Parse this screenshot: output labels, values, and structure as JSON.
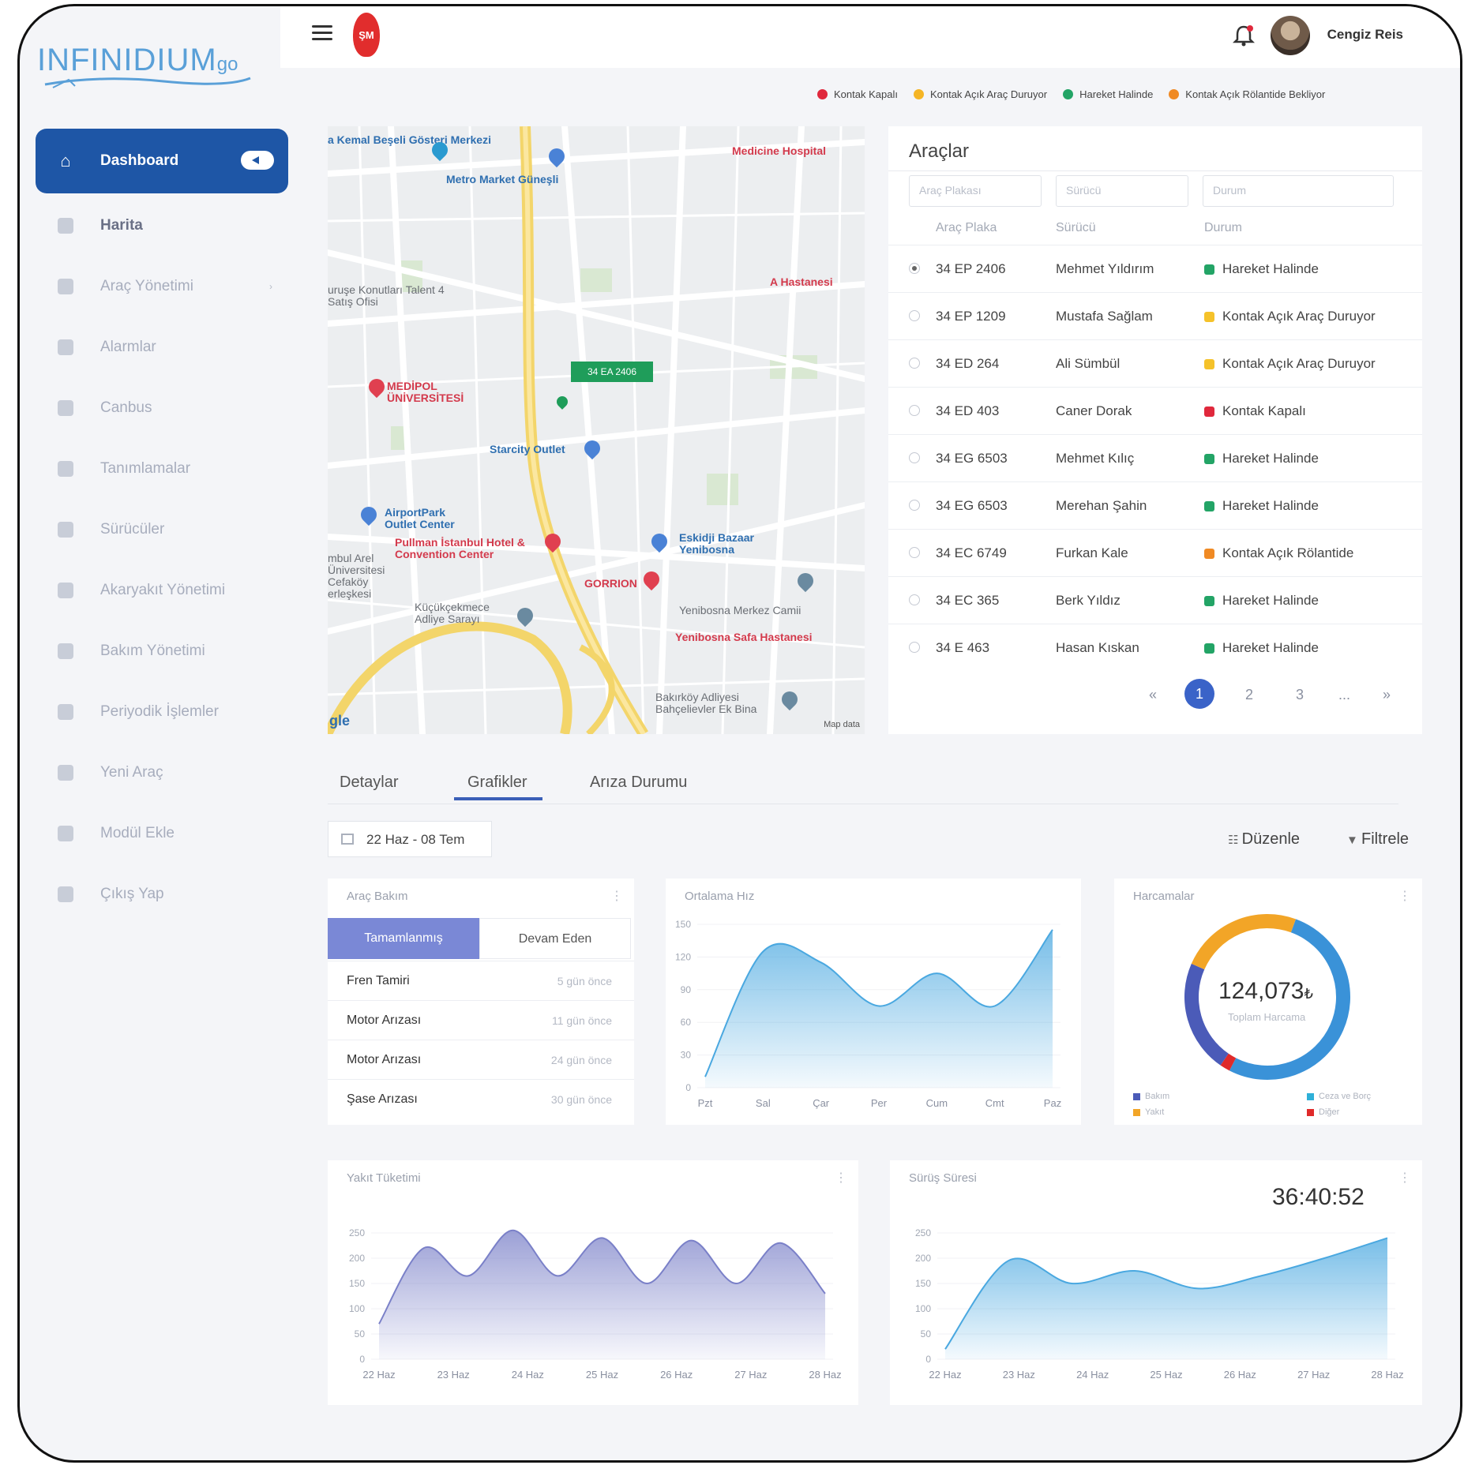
{
  "app": {
    "logo_text": "INFINIDIUM",
    "logo_suffix": "go",
    "emblem_text": "ŞM"
  },
  "user": {
    "name": "Cengiz Reis"
  },
  "sidebar": {
    "items": [
      {
        "label": "Dashboard"
      },
      {
        "label": "Harita"
      },
      {
        "label": "Araç Yönetimi"
      },
      {
        "label": "Alarmlar"
      },
      {
        "label": "Canbus"
      },
      {
        "label": "Tanımlamalar"
      },
      {
        "label": "Sürücüler"
      },
      {
        "label": "Akaryakıt Yönetimi"
      },
      {
        "label": "Bakım Yönetimi"
      },
      {
        "label": "Periyodik İşlemler"
      },
      {
        "label": "Yeni Araç"
      },
      {
        "label": "Modül Ekle"
      },
      {
        "label": "Çıkış Yap"
      }
    ]
  },
  "status_legend": [
    {
      "label": "Kontak Kapalı",
      "color": "#e0283c"
    },
    {
      "label": "Kontak Açık Araç Duruyor",
      "color": "#f5b525"
    },
    {
      "label": "Hareket Halinde",
      "color": "#23a466"
    },
    {
      "label": "Kontak Açık Rölantide Bekliyor",
      "color": "#f08a24"
    }
  ],
  "map": {
    "labels": [
      "a Kemal Beşeli Gösteri Merkezi",
      "Metro Market Güneşli",
      "Medicine Hospital",
      "A Hastanesi",
      "uruşe Konutları Talent 4 Satış Ofisi",
      "MEDİPOL ÜNİVERSİTESİ",
      "Starcity Outlet",
      "AirportPark Outlet Center",
      "Pullman İstanbul Hotel & Convention Center",
      "Eskidji Bazaar Yenibosna",
      "GORRION",
      "Küçükçekmece Adliye Sarayı",
      "Yenibosna Merkez Camii",
      "Yenibosna Safa Hastanesi",
      "Bakırköy Adliyesi Bahçelievler Ek Bina",
      "mbul Arel Üniversitesi Cefaköy erleşkesi",
      "gle"
    ],
    "plate_tag": "34 EA 2406",
    "attribution": "Map data"
  },
  "vehicles": {
    "title": "Araçlar",
    "filters": {
      "plate": "Araç Plakası",
      "driver": "Sürücü",
      "status": "Durum"
    },
    "columns": [
      "Araç Plaka",
      "Sürücü",
      "Durum"
    ],
    "rows": [
      {
        "plate": "34 EP 2406",
        "driver": "Mehmet Yıldırım",
        "status": "Hareket Halinde",
        "color": "#23a466",
        "selected": true
      },
      {
        "plate": "34 EP 1209",
        "driver": "Mustafa Sağlam",
        "status": "Kontak Açık Araç Duruyor",
        "color": "#f5c22a"
      },
      {
        "plate": "34 ED 264",
        "driver": "Ali Sümbül",
        "status": "Kontak Açık Araç Duruyor",
        "color": "#f5c22a"
      },
      {
        "plate": "34 ED 403",
        "driver": "Caner Dorak",
        "status": "Kontak Kapalı",
        "color": "#e0283c"
      },
      {
        "plate": "34 EG 6503",
        "driver": "Mehmet Kılıç",
        "status": "Hareket Halinde",
        "color": "#23a466"
      },
      {
        "plate": "34 EG 6503",
        "driver": "Merehan Şahin",
        "status": "Hareket Halinde",
        "color": "#23a466"
      },
      {
        "plate": "34 EC 6749",
        "driver": "Furkan Kale",
        "status": "Kontak Açık Rölantide",
        "color": "#f08a24"
      },
      {
        "plate": "34 EC 365",
        "driver": "Berk Yıldız",
        "status": "Hareket Halinde",
        "color": "#23a466"
      },
      {
        "plate": "34 E 463",
        "driver": "Hasan Kıskan",
        "status": "Hareket Halinde",
        "color": "#23a466"
      }
    ],
    "pagination": {
      "first": "«",
      "pages": [
        "1",
        "2",
        "3",
        "..."
      ],
      "last": "»",
      "current": "1"
    }
  },
  "tabs": [
    {
      "label": "Detaylar"
    },
    {
      "label": "Grafikler"
    },
    {
      "label": "Arıza Durumu"
    }
  ],
  "active_tab": "Grafikler",
  "date_range": "22 Haz - 08 Tem",
  "actions": {
    "edit": "Düzenle",
    "filter": "Filtrele"
  },
  "maintenance": {
    "title": "Araç Bakım",
    "tabs": [
      "Tamamlanmış",
      "Devam Eden"
    ],
    "rows": [
      {
        "name": "Fren Tamiri",
        "age": "5 gün önce"
      },
      {
        "name": "Motor Arızası",
        "age": "11 gün önce"
      },
      {
        "name": "Motor Arızası",
        "age": "24 gün önce"
      },
      {
        "name": "Şase Arızası",
        "age": "30 gün önce"
      }
    ]
  },
  "expenses": {
    "title": "Harcamalar",
    "total": "124,073",
    "currency": "₺",
    "total_label": "Toplam Harcama",
    "legend": [
      {
        "label": "Bakım",
        "color": "#4b5bb8"
      },
      {
        "label": "Ceza ve Borç",
        "color": "#2fb0d8"
      },
      {
        "label": "Yakıt",
        "color": "#f2a527"
      },
      {
        "label": "Diğer",
        "color": "#e02a2a"
      }
    ]
  },
  "drive_time": {
    "title": "Sürüş Süresi",
    "value": "36:40:52"
  },
  "chart_data": [
    {
      "type": "area",
      "title": "Ortalama Hız",
      "categories": [
        "Pzt",
        "Sal",
        "Çar",
        "Per",
        "Cum",
        "Cmt",
        "Paz"
      ],
      "y_ticks": [
        "150",
        "120",
        "90",
        "60",
        "30",
        "0"
      ],
      "ylim": [
        0,
        150
      ],
      "values": [
        10,
        125,
        115,
        75,
        105,
        75,
        145
      ],
      "color": "#4aa8e0"
    },
    {
      "type": "area",
      "title": "Yakıt Tüketimi",
      "categories": [
        "22 Haz",
        "23 Haz",
        "24 Haz",
        "25 Haz",
        "26 Haz",
        "27 Haz",
        "28 Haz"
      ],
      "y_ticks": [
        "250",
        "200",
        "150",
        "100",
        "50",
        "0"
      ],
      "ylim": [
        0,
        250
      ],
      "values": [
        70,
        220,
        165,
        255,
        165,
        240,
        150,
        235,
        150,
        230,
        130
      ],
      "color": "#7a80c8"
    },
    {
      "type": "area",
      "title": "Sürüş Süresi",
      "categories": [
        "22 Haz",
        "23 Haz",
        "24 Haz",
        "25 Haz",
        "26 Haz",
        "27 Haz",
        "28 Haz"
      ],
      "y_ticks": [
        "250",
        "200",
        "150",
        "100",
        "50",
        "0"
      ],
      "ylim": [
        0,
        250
      ],
      "values": [
        20,
        195,
        150,
        175,
        140,
        165,
        200,
        240
      ],
      "color": "#4aa8e0"
    },
    {
      "type": "pie",
      "title": "Harcamalar",
      "categories": [
        "Bakım",
        "Ceza ve Borç",
        "Yakıt",
        "Diğer"
      ],
      "values": [
        22,
        52,
        24,
        2
      ],
      "colors": [
        "#4b5bb8",
        "#3a92d8",
        "#f2a527",
        "#e02a2a"
      ]
    }
  ]
}
